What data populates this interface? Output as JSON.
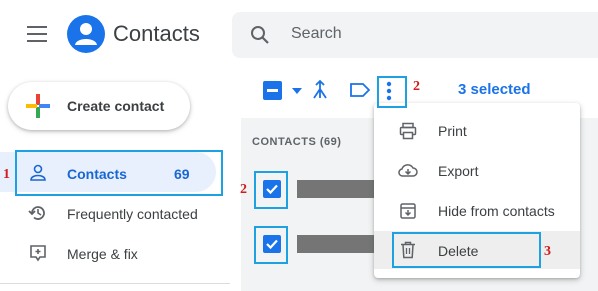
{
  "header": {
    "app_title": "Contacts",
    "search_placeholder": "Search"
  },
  "sidebar": {
    "create_label": "Create contact",
    "items": [
      {
        "label": "Contacts",
        "count": "69",
        "icon": "person-icon"
      },
      {
        "label": "Frequently contacted",
        "icon": "history-icon"
      },
      {
        "label": "Merge & fix",
        "icon": "merge-fix-icon"
      }
    ]
  },
  "toolbar": {
    "selected_text": "3 selected"
  },
  "list": {
    "header": "CONTACTS (69)"
  },
  "menu": {
    "items": [
      {
        "label": "Print",
        "icon": "print-icon"
      },
      {
        "label": "Export",
        "icon": "cloud-export-icon"
      },
      {
        "label": "Hide from contacts",
        "icon": "hide-icon"
      },
      {
        "label": "Delete",
        "icon": "trash-icon"
      }
    ]
  },
  "annotations": {
    "n1": "1",
    "n2a": "2",
    "n2b": "2",
    "n3": "3"
  },
  "colors": {
    "accent": "#1a73e8",
    "annotation_box": "#1ea1e0",
    "annotation_number": "#d01c1c"
  }
}
